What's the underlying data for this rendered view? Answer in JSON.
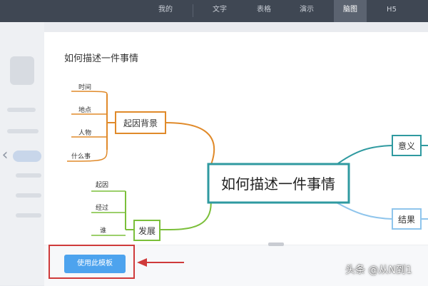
{
  "nav": {
    "items": [
      "我的",
      "文字",
      "表格",
      "演示",
      "脑图",
      "H5"
    ],
    "active": "脑图"
  },
  "template": {
    "title": "如何描述一件事情",
    "mindmap": {
      "root": "如何描述一件事情",
      "branches": {
        "cause": {
          "label": "起因背景",
          "color": "#e08a2a",
          "children": [
            "时间",
            "地点",
            "人物",
            "什么事"
          ]
        },
        "development": {
          "label": "发展",
          "color": "#7bbf3a",
          "children": [
            "起因",
            "经过",
            "谁"
          ]
        },
        "meaning": {
          "label": "意义",
          "color": "#2f9aa0"
        },
        "result": {
          "label": "结果",
          "color": "#8fc5ec"
        }
      },
      "root_border_color": "#2f9aa0"
    }
  },
  "actions": {
    "use_template": "使用此模板"
  },
  "watermark": "头条 @从N到1",
  "colors": {
    "topbar": "#3f4753",
    "button": "#4da3ee",
    "highlight": "#cf3a3a"
  }
}
